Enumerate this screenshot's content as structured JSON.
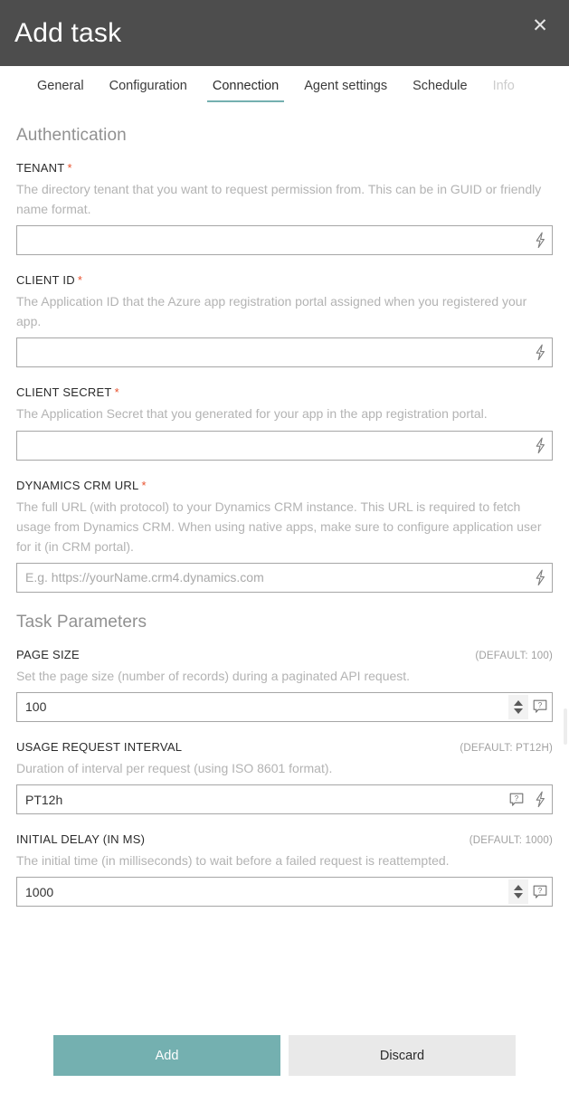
{
  "header": {
    "title": "Add task",
    "close_icon": "close-icon"
  },
  "tabs": [
    {
      "label": "General",
      "state": "normal"
    },
    {
      "label": "Configuration",
      "state": "normal"
    },
    {
      "label": "Connection",
      "state": "active"
    },
    {
      "label": "Agent settings",
      "state": "normal"
    },
    {
      "label": "Schedule",
      "state": "normal"
    },
    {
      "label": "Info",
      "state": "disabled"
    }
  ],
  "sections": [
    {
      "title": "Authentication",
      "fields": [
        {
          "label": "TENANT",
          "required": true,
          "default_hint": "",
          "description": "The directory tenant that you want to request permission from. This can be in GUID or friendly name format.",
          "value": "",
          "placeholder": "",
          "adornments": [
            "lightning-icon"
          ]
        },
        {
          "label": "CLIENT ID",
          "required": true,
          "default_hint": "",
          "description": "The Application ID that the Azure app registration portal assigned when you registered your app.",
          "value": "",
          "placeholder": "",
          "adornments": [
            "lightning-icon"
          ]
        },
        {
          "label": "CLIENT SECRET",
          "required": true,
          "default_hint": "",
          "description": "The Application Secret that you generated for your app in the app registration portal.",
          "value": "",
          "placeholder": "",
          "adornments": [
            "lightning-icon"
          ]
        },
        {
          "label": "DYNAMICS CRM URL",
          "required": true,
          "default_hint": "",
          "description": "The full URL (with protocol) to your Dynamics CRM instance. This URL is required to fetch usage from Dynamics CRM. When using native apps, make sure to configure application user for it (in CRM portal).",
          "value": "",
          "placeholder": "E.g. https://yourName.crm4.dynamics.com",
          "adornments": [
            "lightning-icon"
          ]
        }
      ]
    },
    {
      "title": "Task Parameters",
      "fields": [
        {
          "label": "PAGE SIZE",
          "required": false,
          "default_hint": "(DEFAULT: 100)",
          "description": "Set the page size (number of records) during a paginated API request.",
          "value": "100",
          "placeholder": "",
          "adornments": [
            "spinner",
            "help-icon"
          ]
        },
        {
          "label": "USAGE REQUEST INTERVAL",
          "required": false,
          "default_hint": "(DEFAULT: PT12H)",
          "description": "Duration of interval per request (using ISO 8601 format).",
          "value": "PT12h",
          "placeholder": "",
          "adornments": [
            "help-icon",
            "lightning-icon"
          ]
        },
        {
          "label": "INITIAL DELAY (IN MS)",
          "required": false,
          "default_hint": "(DEFAULT: 1000)",
          "description": "The initial time (in milliseconds) to wait before a failed request is reattempted.",
          "value": "1000",
          "placeholder": "",
          "adornments": [
            "spinner",
            "help-icon"
          ]
        }
      ]
    }
  ],
  "footer": {
    "primary_label": "Add",
    "secondary_label": "Discard"
  },
  "colors": {
    "header_bg": "#4d4d4d",
    "accent": "#74b0b0",
    "required_star": "#e8522e",
    "secondary_btn": "#e9e9e9",
    "description_text": "#b3b3b3"
  }
}
